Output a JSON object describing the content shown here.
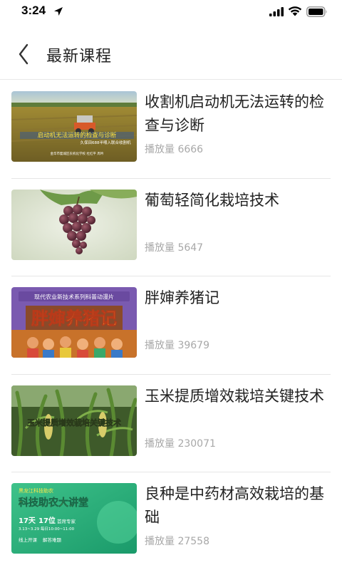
{
  "status_bar": {
    "time": "3:24"
  },
  "nav": {
    "title": "最新课程"
  },
  "play_label": "播放量",
  "thumb_text": {
    "t1_title": "启动机无法运转的检查与诊断",
    "t1_sub": "久保田688半喂入联合收割机",
    "t1_credit": "金华市婺城区农机化学校 杜红平 周吟",
    "t3_banner": "现代农业新技术系列科普动漫片",
    "t3_title": "胖婶养猪记",
    "t4_title": "玉米提质增效栽培关键技术",
    "t5_top": "黑龙江科技助农",
    "t5_title": "科技助农大讲堂",
    "t5_days": "17天",
    "t5_experts": "17位",
    "t5_experts_label": "首席专家",
    "t5_dates": "3.13~3.29 每日10:00~11:00",
    "t5_bottom1": "线上开课",
    "t5_bottom2": "解答难题"
  },
  "courses": [
    {
      "title": "收割机启动机无法运转的检查与诊断",
      "plays": "6666"
    },
    {
      "title": "葡萄轻简化栽培技术",
      "plays": "5647"
    },
    {
      "title": "胖婶养猪记",
      "plays": "39679"
    },
    {
      "title": "玉米提质增效栽培关键技术",
      "plays": "230071"
    },
    {
      "title": "良种是中药材高效栽培的基础",
      "plays": "27558"
    }
  ]
}
